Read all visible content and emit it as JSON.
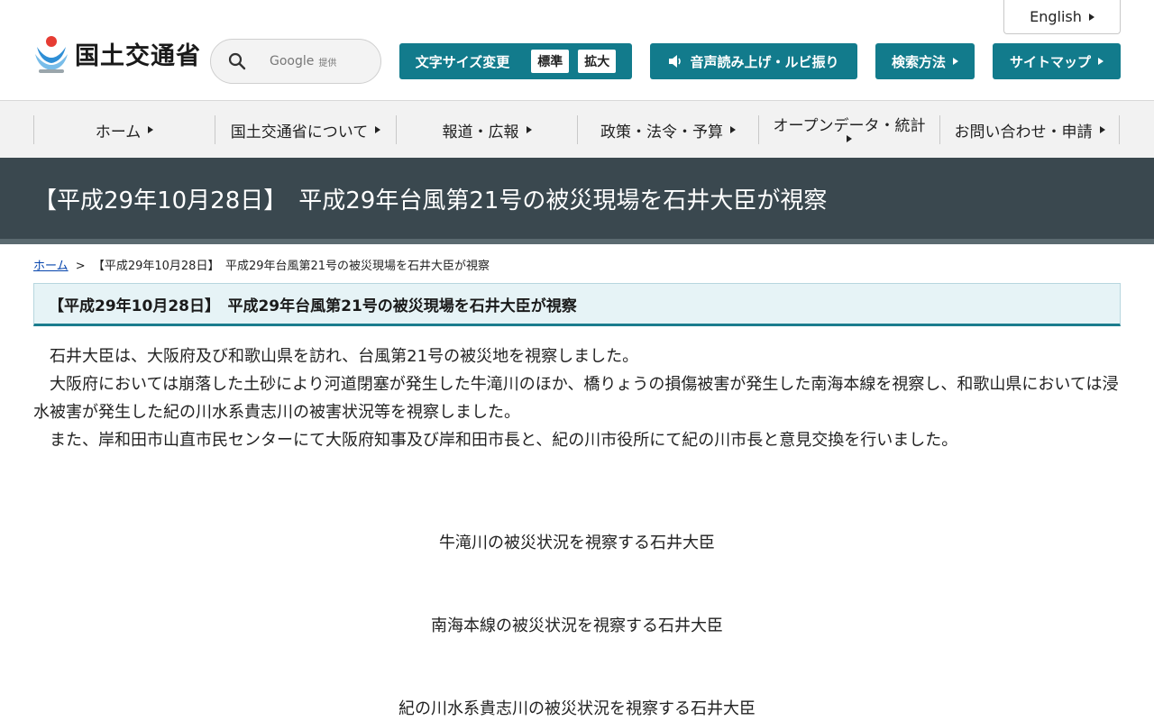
{
  "header": {
    "english_label": "English",
    "logo_text": "国土交通省",
    "search": {
      "brand": "Google",
      "sub": "提供"
    },
    "font_size": {
      "label": "文字サイズ変更",
      "standard": "標準",
      "large": "拡大"
    },
    "voice_label": "音声読み上げ・ルビ振り",
    "search_method_label": "検索方法",
    "sitemap_label": "サイトマップ"
  },
  "nav": {
    "items": [
      "ホーム",
      "国土交通省について",
      "報道・広報",
      "政策・法令・予算",
      "オープンデータ・統計",
      "お問い合わせ・申請"
    ]
  },
  "page": {
    "title": "【平成29年10月28日】　平成29年台風第21号の被災現場を石井大臣が視察",
    "breadcrumb": {
      "home": "ホーム",
      "separator": ">",
      "current": "【平成29年10月28日】　平成29年台風第21号の被災現場を石井大臣が視察"
    },
    "section_heading": "【平成29年10月28日】　平成29年台風第21号の被災現場を石井大臣が視察",
    "paragraphs": [
      "石井大臣は、大阪府及び和歌山県を訪れ、台風第21号の被災地を視察しました。",
      "大阪府においては崩落した土砂により河道閉塞が発生した牛滝川のほか、橋りょうの損傷被害が発生した南海本線を視察し、和歌山県においては浸水被害が発生した紀の川水系貴志川の被害状況等を視察しました。",
      "また、岸和田市山直市民センターにて大阪府知事及び岸和田市長と、紀の川市役所にて紀の川市長と意見交換を行いました。"
    ],
    "captions": [
      "牛滝川の被災状況を視察する石井大臣",
      "南海本線の被災状況を視察する石井大臣",
      "紀の川水系貴志川の被災状況を視察する石井大臣"
    ]
  },
  "colors": {
    "accent": "#127b8c",
    "title_band": "#3a484f",
    "nav_bg": "#f2f2f2",
    "section_bg": "#e6f3f6"
  }
}
